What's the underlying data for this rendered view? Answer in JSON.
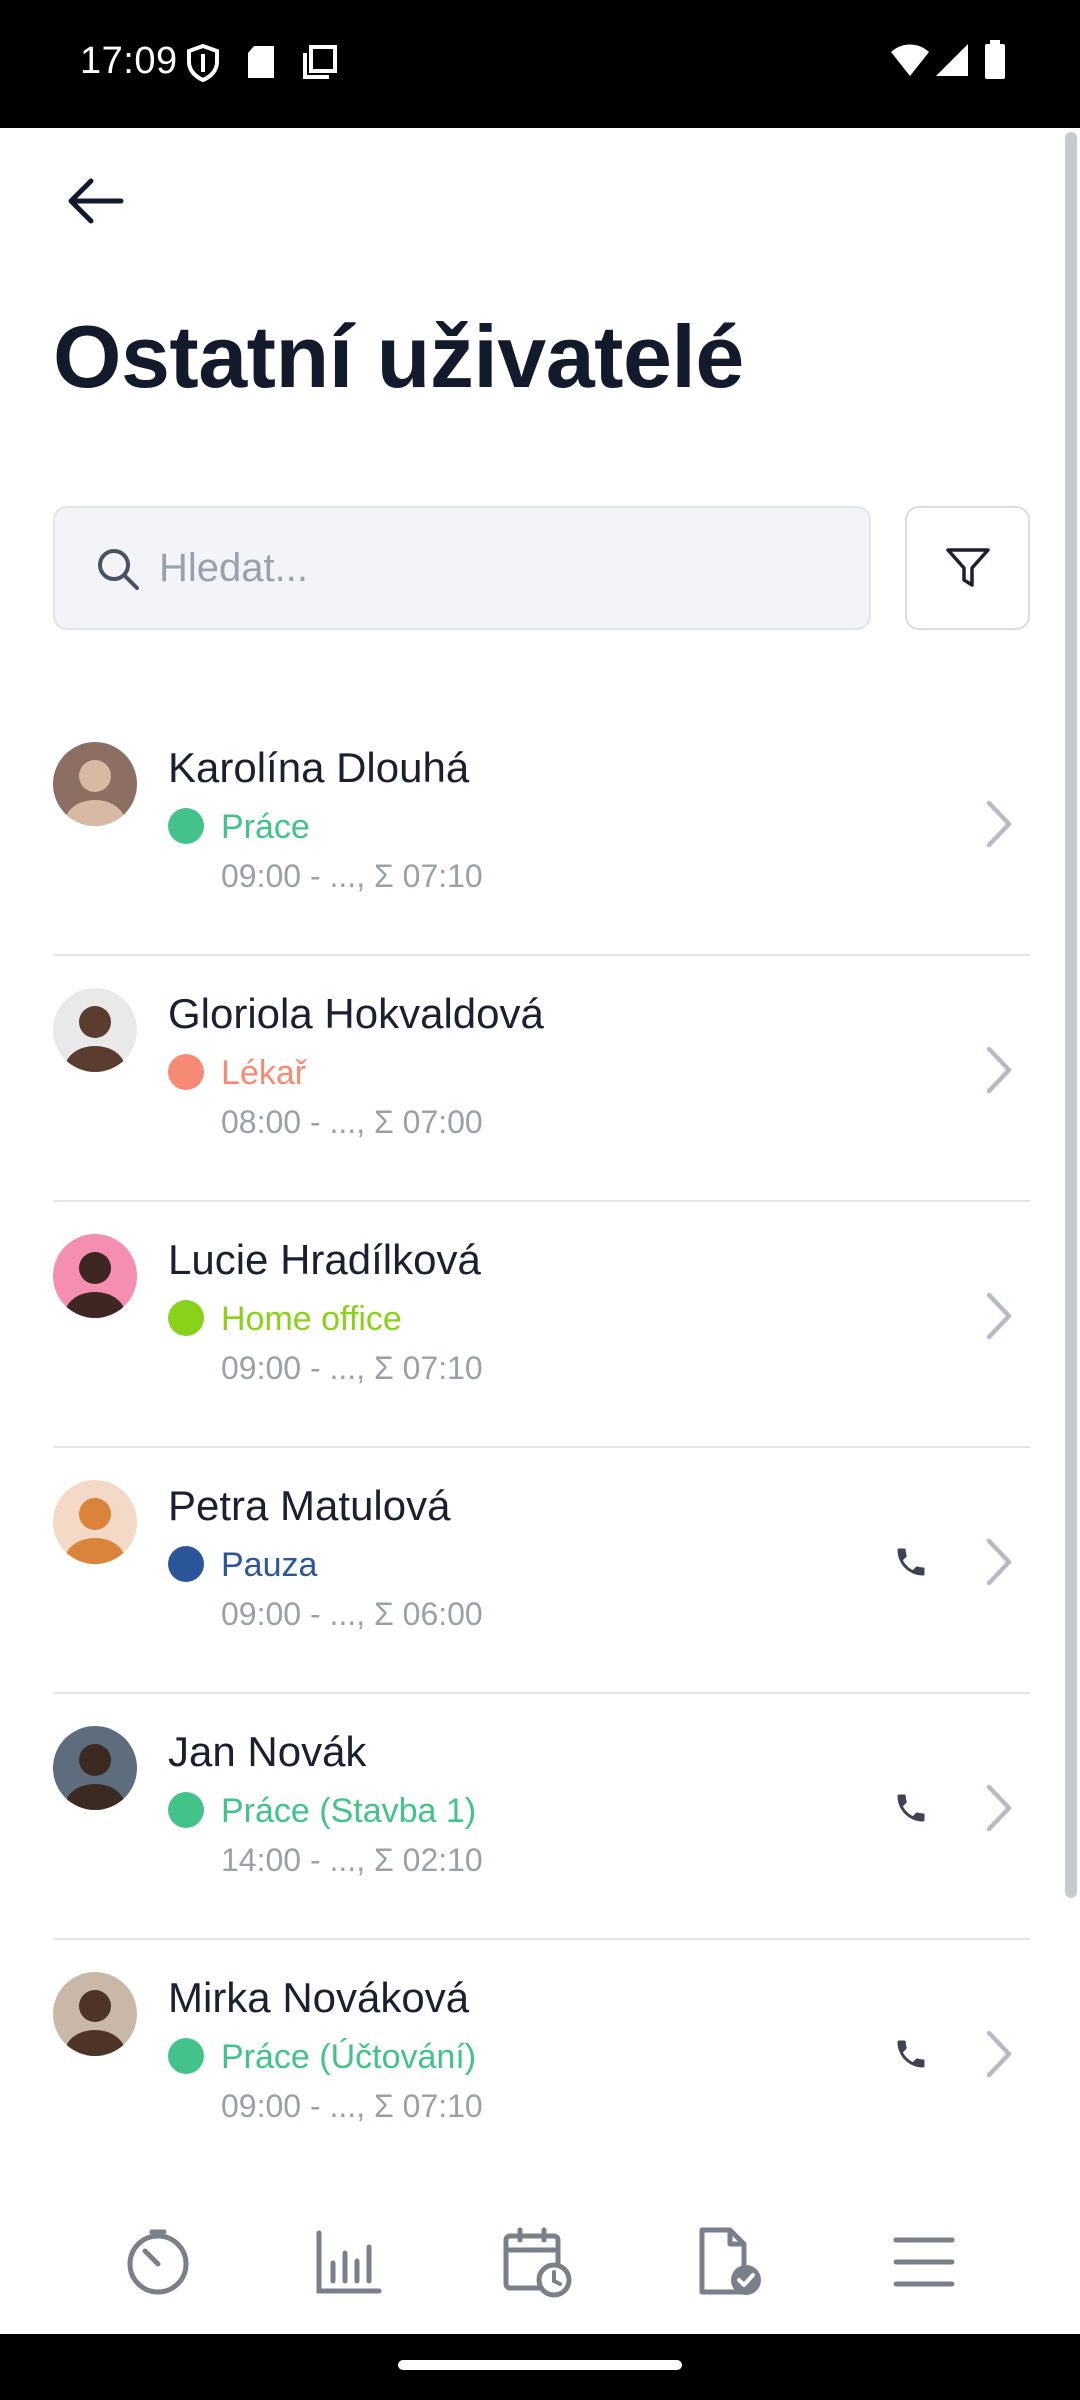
{
  "status_bar": {
    "time": "17:09",
    "left_icons": [
      "shield-icon",
      "sd-card-icon",
      "screenshot-icon"
    ],
    "right_icons": [
      "wifi-icon",
      "signal-icon",
      "battery-icon"
    ]
  },
  "header": {
    "back_icon": "arrow-left-icon",
    "title": "Ostatní uživatelé"
  },
  "search": {
    "placeholder": "Hledat...",
    "value": ""
  },
  "filter_icon": "filter-icon",
  "users": [
    {
      "name": "Karolína Dlouhá",
      "status": "Práce",
      "status_color": "#43c38a",
      "time": "09:00 - ..., Σ 07:10",
      "phone": false
    },
    {
      "name": "Gloriola Hokvaldová",
      "status": "Lékař",
      "status_color": "#f78a75",
      "time": "08:00 - ..., Σ 07:00",
      "phone": false
    },
    {
      "name": "Lucie Hradílková",
      "status": "Home office",
      "status_color": "#8ad21a",
      "time": "09:00 - ..., Σ 07:10",
      "phone": false
    },
    {
      "name": "Petra Matulová",
      "status": "Pauza",
      "status_color": "#2b579a",
      "time": "09:00 - ..., Σ 06:00",
      "phone": true
    },
    {
      "name": "Jan Novák",
      "status": "Práce (Stavba 1)",
      "status_color": "#43c38a",
      "time": "14:00 - ..., Σ 02:10",
      "phone": true
    },
    {
      "name": "Mirka Nováková",
      "status": "Práce (Účtování)",
      "status_color": "#43c38a",
      "time": "09:00 - ..., Σ 07:10",
      "phone": true
    }
  ],
  "bottom_nav": [
    "timer-icon",
    "stats-icon",
    "calendar-clock-icon",
    "document-check-icon",
    "menu-icon"
  ],
  "colors": {
    "title": "#121a2b",
    "nav_icon": "#7a808a",
    "divider": "#e4e6ea"
  }
}
